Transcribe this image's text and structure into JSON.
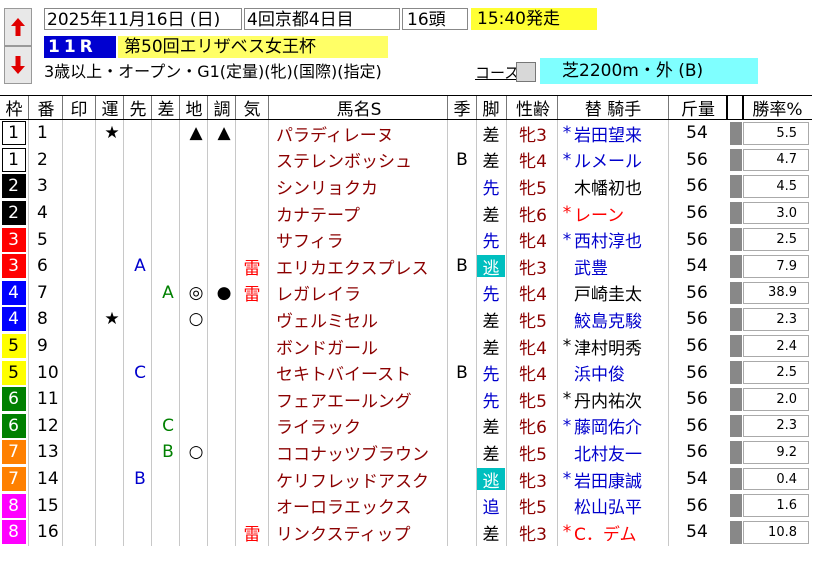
{
  "header": {
    "date": "2025年11月16日 (日)",
    "meet": "4回京都4日目",
    "heads": "16頭",
    "start_time": "15:40発走",
    "race_no": "11R",
    "race_name": "第50回エリザベス女王杯",
    "conditions": "3歳以上・オープン・G1(定量)(牝)(国際)(指定)",
    "course_link": "コース図",
    "course": "芝2200m・外 (B)"
  },
  "columns": [
    "枠",
    "番",
    "印",
    "運",
    "先",
    "差",
    "地",
    "調",
    "気",
    "馬名S",
    "季",
    "脚",
    "性齢",
    "替 騎手",
    "斤量",
    "勝率%"
  ],
  "colors": {
    "waku": [
      "#ffffff",
      "#000000",
      "#ff0000",
      "#0000ff",
      "#ffff00",
      "#008000",
      "#ff8000",
      "#ff00ff"
    ],
    "waku_text": [
      "#000000",
      "#ffffff",
      "#ffffff",
      "#ffffff",
      "#000000",
      "#ffffff",
      "#ffffff",
      "#ffffff"
    ],
    "start_bg": "#ffff33",
    "race_no_bg": "#0000d0",
    "race_name_bg": "#ffff66",
    "course_bg": "#7fffff",
    "horse_name": "#8b0000",
    "nige_bg": "#00bfbf"
  },
  "rows": [
    {
      "waku": "1",
      "ban": "1",
      "shirushi": "",
      "un": "★",
      "saki": "",
      "sashi": "",
      "chi": "▲",
      "cho": "▲",
      "ki": "",
      "name": "パラディレーヌ",
      "season": "",
      "kyaku": "差",
      "sex": "牝3",
      "kae": "*",
      "jockey": "岩田望来",
      "jock_color": "blue",
      "kin": "54",
      "odds": "5.5",
      "odds_value": 5.5
    },
    {
      "waku": "1",
      "ban": "2",
      "shirushi": "",
      "un": "",
      "saki": "",
      "sashi": "",
      "chi": "",
      "cho": "",
      "ki": "",
      "name": "ステレンボッシュ",
      "season": "B",
      "kyaku": "差",
      "sex": "牝4",
      "kae": "*",
      "jockey": "ルメール",
      "jock_color": "blue",
      "kin": "56",
      "odds": "4.7",
      "odds_value": 4.7
    },
    {
      "waku": "2",
      "ban": "3",
      "shirushi": "",
      "un": "",
      "saki": "",
      "sashi": "",
      "chi": "",
      "cho": "",
      "ki": "",
      "name": "シンリョクカ",
      "season": "",
      "kyaku": "先",
      "sex": "牝5",
      "kae": "",
      "jockey": "木幡初也",
      "jock_color": "black",
      "kin": "56",
      "odds": "4.5",
      "odds_value": 4.5
    },
    {
      "waku": "2",
      "ban": "4",
      "shirushi": "",
      "un": "",
      "saki": "",
      "sashi": "",
      "chi": "",
      "cho": "",
      "ki": "",
      "name": "カナテープ",
      "season": "",
      "kyaku": "差",
      "sex": "牝6",
      "kae": "*",
      "jockey": "レーン",
      "jock_color": "red",
      "kin": "56",
      "odds": "3.0",
      "odds_value": 3.0
    },
    {
      "waku": "3",
      "ban": "5",
      "shirushi": "",
      "un": "",
      "saki": "",
      "sashi": "",
      "chi": "",
      "cho": "",
      "ki": "",
      "name": "サフィラ",
      "season": "",
      "kyaku": "先",
      "sex": "牝4",
      "kae": "*",
      "jockey": "西村淳也",
      "jock_color": "blue",
      "kin": "56",
      "odds": "2.5",
      "odds_value": 2.5
    },
    {
      "waku": "3",
      "ban": "6",
      "shirushi": "",
      "un": "",
      "saki": "A",
      "sashi": "",
      "chi": "",
      "cho": "",
      "ki": "雷",
      "name": "エリカエクスプレス",
      "season": "B",
      "kyaku": "逃",
      "sex": "牝3",
      "kae": "",
      "jockey": "武豊",
      "jock_color": "blue",
      "kin": "54",
      "odds": "7.9",
      "odds_value": 7.9
    },
    {
      "waku": "4",
      "ban": "7",
      "shirushi": "",
      "un": "",
      "saki": "",
      "sashi": "A",
      "chi": "◎",
      "cho": "●",
      "ki": "雷",
      "name": "レガレイラ",
      "season": "",
      "kyaku": "先",
      "sex": "牝4",
      "kae": "",
      "jockey": "戸崎圭太",
      "jock_color": "black",
      "kin": "56",
      "odds": "38.9",
      "odds_value": 38.9
    },
    {
      "waku": "4",
      "ban": "8",
      "shirushi": "",
      "un": "★",
      "saki": "",
      "sashi": "",
      "chi": "○",
      "cho": "",
      "ki": "",
      "name": "ヴェルミセル",
      "season": "",
      "kyaku": "差",
      "sex": "牝5",
      "kae": "",
      "jockey": "鮫島克駿",
      "jock_color": "blue",
      "kin": "56",
      "odds": "2.3",
      "odds_value": 2.3
    },
    {
      "waku": "5",
      "ban": "9",
      "shirushi": "",
      "un": "",
      "saki": "",
      "sashi": "",
      "chi": "",
      "cho": "",
      "ki": "",
      "name": "ボンドガール",
      "season": "",
      "kyaku": "差",
      "sex": "牝4",
      "kae": "*",
      "jockey": "津村明秀",
      "jock_color": "black",
      "kin": "56",
      "odds": "2.4",
      "odds_value": 2.4
    },
    {
      "waku": "5",
      "ban": "10",
      "shirushi": "",
      "un": "",
      "saki": "C",
      "sashi": "",
      "chi": "",
      "cho": "",
      "ki": "",
      "name": "セキトバイースト",
      "season": "B",
      "kyaku": "先",
      "sex": "牝4",
      "kae": "",
      "jockey": "浜中俊",
      "jock_color": "blue",
      "kin": "56",
      "odds": "2.5",
      "odds_value": 2.5
    },
    {
      "waku": "6",
      "ban": "11",
      "shirushi": "",
      "un": "",
      "saki": "",
      "sashi": "",
      "chi": "",
      "cho": "",
      "ki": "",
      "name": "フェアエールング",
      "season": "",
      "kyaku": "先",
      "sex": "牝5",
      "kae": "*",
      "jockey": "丹内祐次",
      "jock_color": "black",
      "kin": "56",
      "odds": "2.0",
      "odds_value": 2.0
    },
    {
      "waku": "6",
      "ban": "12",
      "shirushi": "",
      "un": "",
      "saki": "",
      "sashi": "C",
      "chi": "",
      "cho": "",
      "ki": "",
      "name": "ライラック",
      "season": "",
      "kyaku": "差",
      "sex": "牝6",
      "kae": "*",
      "jockey": "藤岡佑介",
      "jock_color": "blue",
      "kin": "56",
      "odds": "2.3",
      "odds_value": 2.3
    },
    {
      "waku": "7",
      "ban": "13",
      "shirushi": "",
      "un": "",
      "saki": "",
      "sashi": "B",
      "chi": "○",
      "cho": "",
      "ki": "",
      "name": "ココナッツブラウン",
      "season": "",
      "kyaku": "差",
      "sex": "牝5",
      "kae": "",
      "jockey": "北村友一",
      "jock_color": "blue",
      "kin": "56",
      "odds": "9.2",
      "odds_value": 9.2
    },
    {
      "waku": "7",
      "ban": "14",
      "shirushi": "",
      "un": "",
      "saki": "B",
      "sashi": "",
      "chi": "",
      "cho": "",
      "ki": "",
      "name": "ケリフレッドアスク",
      "season": "",
      "kyaku": "逃",
      "sex": "牝3",
      "kae": "*",
      "jockey": "岩田康誠",
      "jock_color": "blue",
      "kin": "54",
      "odds": "0.4",
      "odds_value": 0.4
    },
    {
      "waku": "8",
      "ban": "15",
      "shirushi": "",
      "un": "",
      "saki": "",
      "sashi": "",
      "chi": "",
      "cho": "",
      "ki": "",
      "name": "オーロラエックス",
      "season": "",
      "kyaku": "追",
      "sex": "牝5",
      "kae": "",
      "jockey": "松山弘平",
      "jock_color": "blue",
      "kin": "56",
      "odds": "1.6",
      "odds_value": 1.6
    },
    {
      "waku": "8",
      "ban": "16",
      "shirushi": "",
      "un": "",
      "saki": "",
      "sashi": "",
      "chi": "",
      "cho": "",
      "ki": "雷",
      "name": "リンクスティップ",
      "season": "",
      "kyaku": "差",
      "sex": "牝3",
      "kae": "*",
      "jockey": "C．デム",
      "jock_color": "red",
      "kin": "54",
      "odds": "10.8",
      "odds_value": 10.8
    }
  ]
}
